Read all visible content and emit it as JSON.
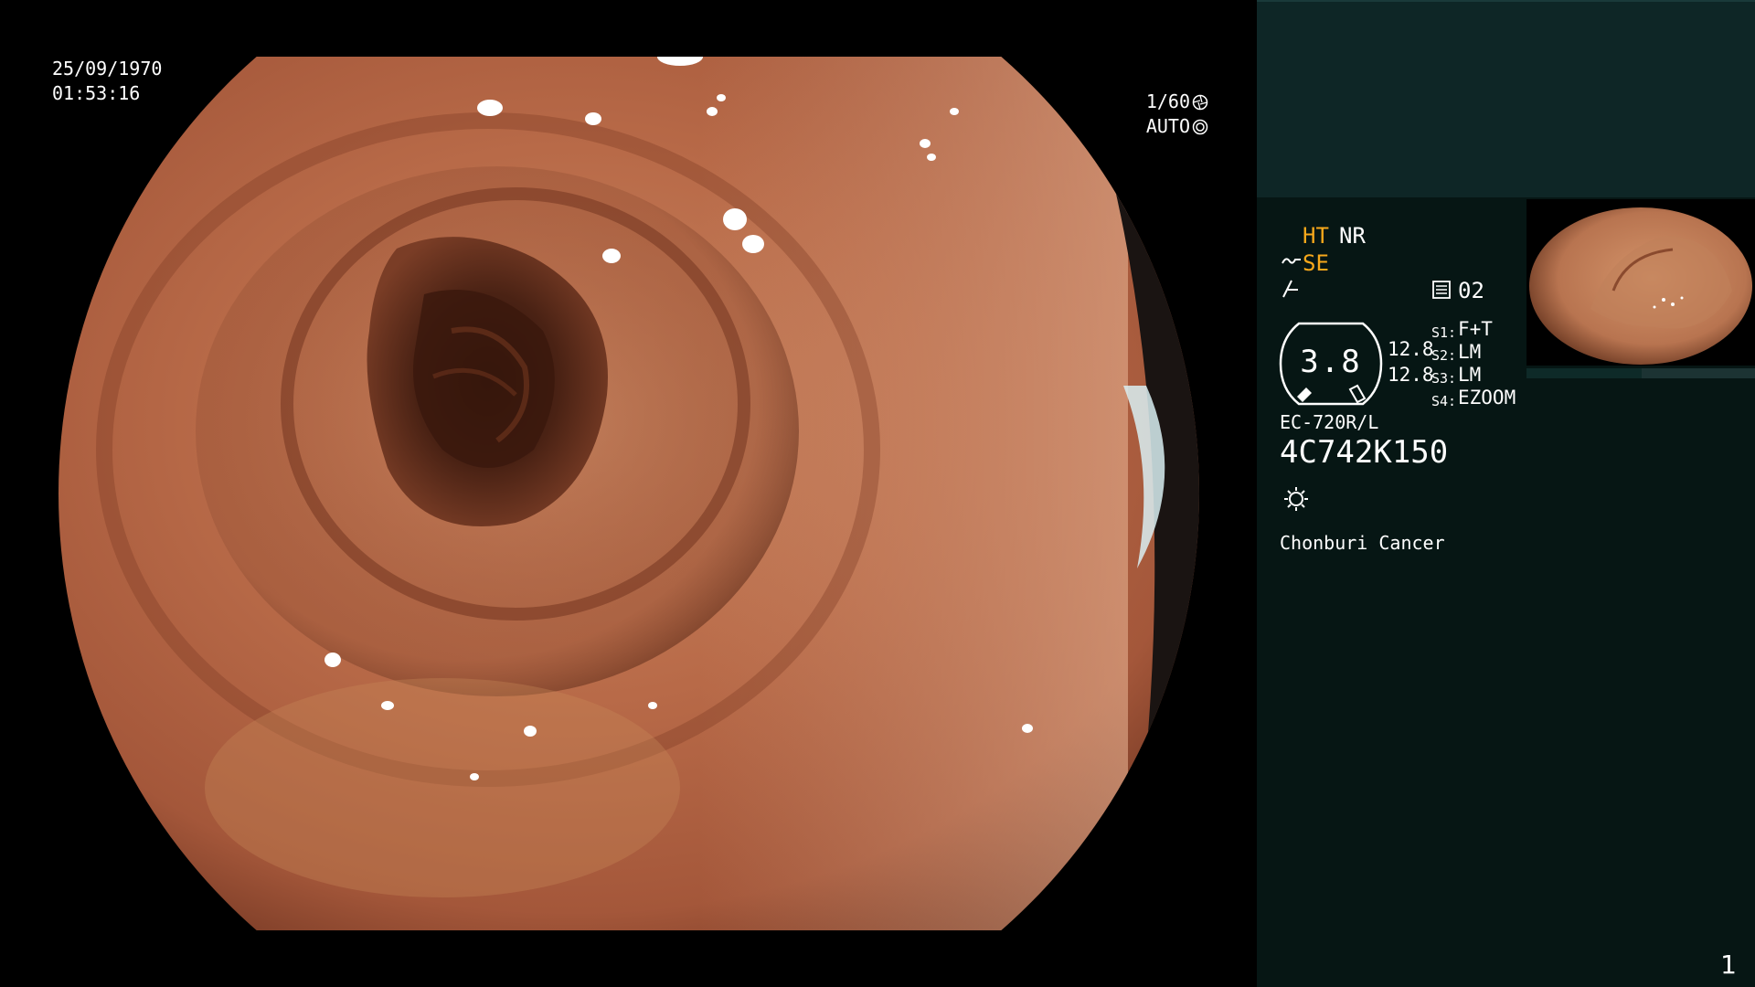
{
  "overlay": {
    "date": "25/09/1970",
    "time": "01:53:16",
    "shutter_speed": "1/60",
    "iris_mode": "AUTO"
  },
  "info_panel": {
    "image_modes": {
      "ht": "HT",
      "nr": "NR",
      "se": "SE"
    },
    "memory_number": "02",
    "zoom_level": "3.8",
    "gain_values": [
      "12.8",
      "12.8"
    ],
    "scope_switches": [
      {
        "label": "S1:",
        "value": "F+T"
      },
      {
        "label": "S2:",
        "value": "LM"
      },
      {
        "label": "S3:",
        "value": "LM"
      },
      {
        "label": "S4:",
        "value": "EZOOM"
      }
    ],
    "scope_model": "EC-720R/L",
    "scope_serial": "4C742K150",
    "hospital_name": "Chonburi Cancer",
    "page_number": "1"
  },
  "icons": [
    "shutter-icon",
    "iris-icon",
    "structure-enhance-icon",
    "color-enhance-icon",
    "memory-icon",
    "light-icon"
  ],
  "colors": {
    "mode_highlight": "#f7a81b",
    "panel_background": "#061614",
    "panel_header": "#0e2626"
  }
}
